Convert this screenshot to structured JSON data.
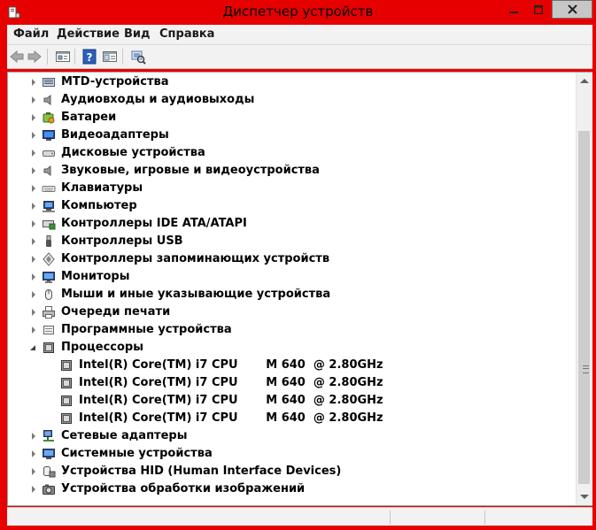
{
  "window": {
    "title": "Диспетчер устройств",
    "controls": {
      "minimize": "–",
      "maximize": "□",
      "close": "✕"
    }
  },
  "menu": {
    "items": [
      {
        "label": "Файл"
      },
      {
        "label": "Действие"
      },
      {
        "label": "Вид"
      },
      {
        "label": "Справка"
      }
    ]
  },
  "toolbar": {
    "buttons": [
      {
        "name": "back",
        "icon": "arrow-left-icon"
      },
      {
        "name": "forward",
        "icon": "arrow-right-icon"
      },
      {
        "name": "properties",
        "icon": "properties-icon"
      },
      {
        "name": "help",
        "icon": "help-icon"
      },
      {
        "name": "view",
        "icon": "view-pane-icon"
      },
      {
        "name": "scan",
        "icon": "scan-hardware-icon"
      }
    ]
  },
  "tree": {
    "items": [
      {
        "label": "MTD-устройства",
        "icon": "mtd-icon",
        "expanded": false,
        "level": 0
      },
      {
        "label": "Аудиовходы и аудиовыходы",
        "icon": "speaker-icon",
        "expanded": false,
        "level": 0
      },
      {
        "label": "Батареи",
        "icon": "battery-icon",
        "expanded": false,
        "level": 0
      },
      {
        "label": "Видеоадаптеры",
        "icon": "display-adapter-icon",
        "expanded": false,
        "level": 0
      },
      {
        "label": "Дисковые устройства",
        "icon": "disk-drive-icon",
        "expanded": false,
        "level": 0
      },
      {
        "label": "Звуковые, игровые и видеоустройства",
        "icon": "sound-icon",
        "expanded": false,
        "level": 0
      },
      {
        "label": "Клавиатуры",
        "icon": "keyboard-icon",
        "expanded": false,
        "level": 0
      },
      {
        "label": "Компьютер",
        "icon": "computer-icon",
        "expanded": false,
        "level": 0
      },
      {
        "label": "Контроллеры IDE ATA/ATAPI",
        "icon": "ide-controller-icon",
        "expanded": false,
        "level": 0
      },
      {
        "label": "Контроллеры USB",
        "icon": "usb-icon",
        "expanded": false,
        "level": 0
      },
      {
        "label": "Контроллеры запоминающих устройств",
        "icon": "storage-controller-icon",
        "expanded": false,
        "level": 0
      },
      {
        "label": "Мониторы",
        "icon": "monitor-icon",
        "expanded": false,
        "level": 0
      },
      {
        "label": "Мыши и иные указывающие устройства",
        "icon": "mouse-icon",
        "expanded": false,
        "level": 0
      },
      {
        "label": "Очереди печати",
        "icon": "printer-icon",
        "expanded": false,
        "level": 0
      },
      {
        "label": "Программные устройства",
        "icon": "software-device-icon",
        "expanded": false,
        "level": 0
      },
      {
        "label": "Процессоры",
        "icon": "processor-icon",
        "expanded": true,
        "level": 0
      },
      {
        "label": "Intel(R) Core(TM) i7 CPU       M 640  @ 2.80GHz",
        "icon": "processor-icon",
        "level": 1
      },
      {
        "label": "Intel(R) Core(TM) i7 CPU       M 640  @ 2.80GHz",
        "icon": "processor-icon",
        "level": 1
      },
      {
        "label": "Intel(R) Core(TM) i7 CPU       M 640  @ 2.80GHz",
        "icon": "processor-icon",
        "level": 1
      },
      {
        "label": "Intel(R) Core(TM) i7 CPU       M 640  @ 2.80GHz",
        "icon": "processor-icon",
        "level": 1
      },
      {
        "label": "Сетевые адаптеры",
        "icon": "network-adapter-icon",
        "expanded": false,
        "level": 0
      },
      {
        "label": "Системные устройства",
        "icon": "system-device-icon",
        "expanded": false,
        "level": 0
      },
      {
        "label": "Устройства HID (Human Interface Devices)",
        "icon": "hid-icon",
        "expanded": false,
        "level": 0
      },
      {
        "label": "Устройства обработки изображений",
        "icon": "imaging-device-icon",
        "expanded": false,
        "level": 0
      }
    ]
  },
  "colors": {
    "frame": "#e60000",
    "background": "#ffffff",
    "chrome": "#f2f2f2"
  }
}
